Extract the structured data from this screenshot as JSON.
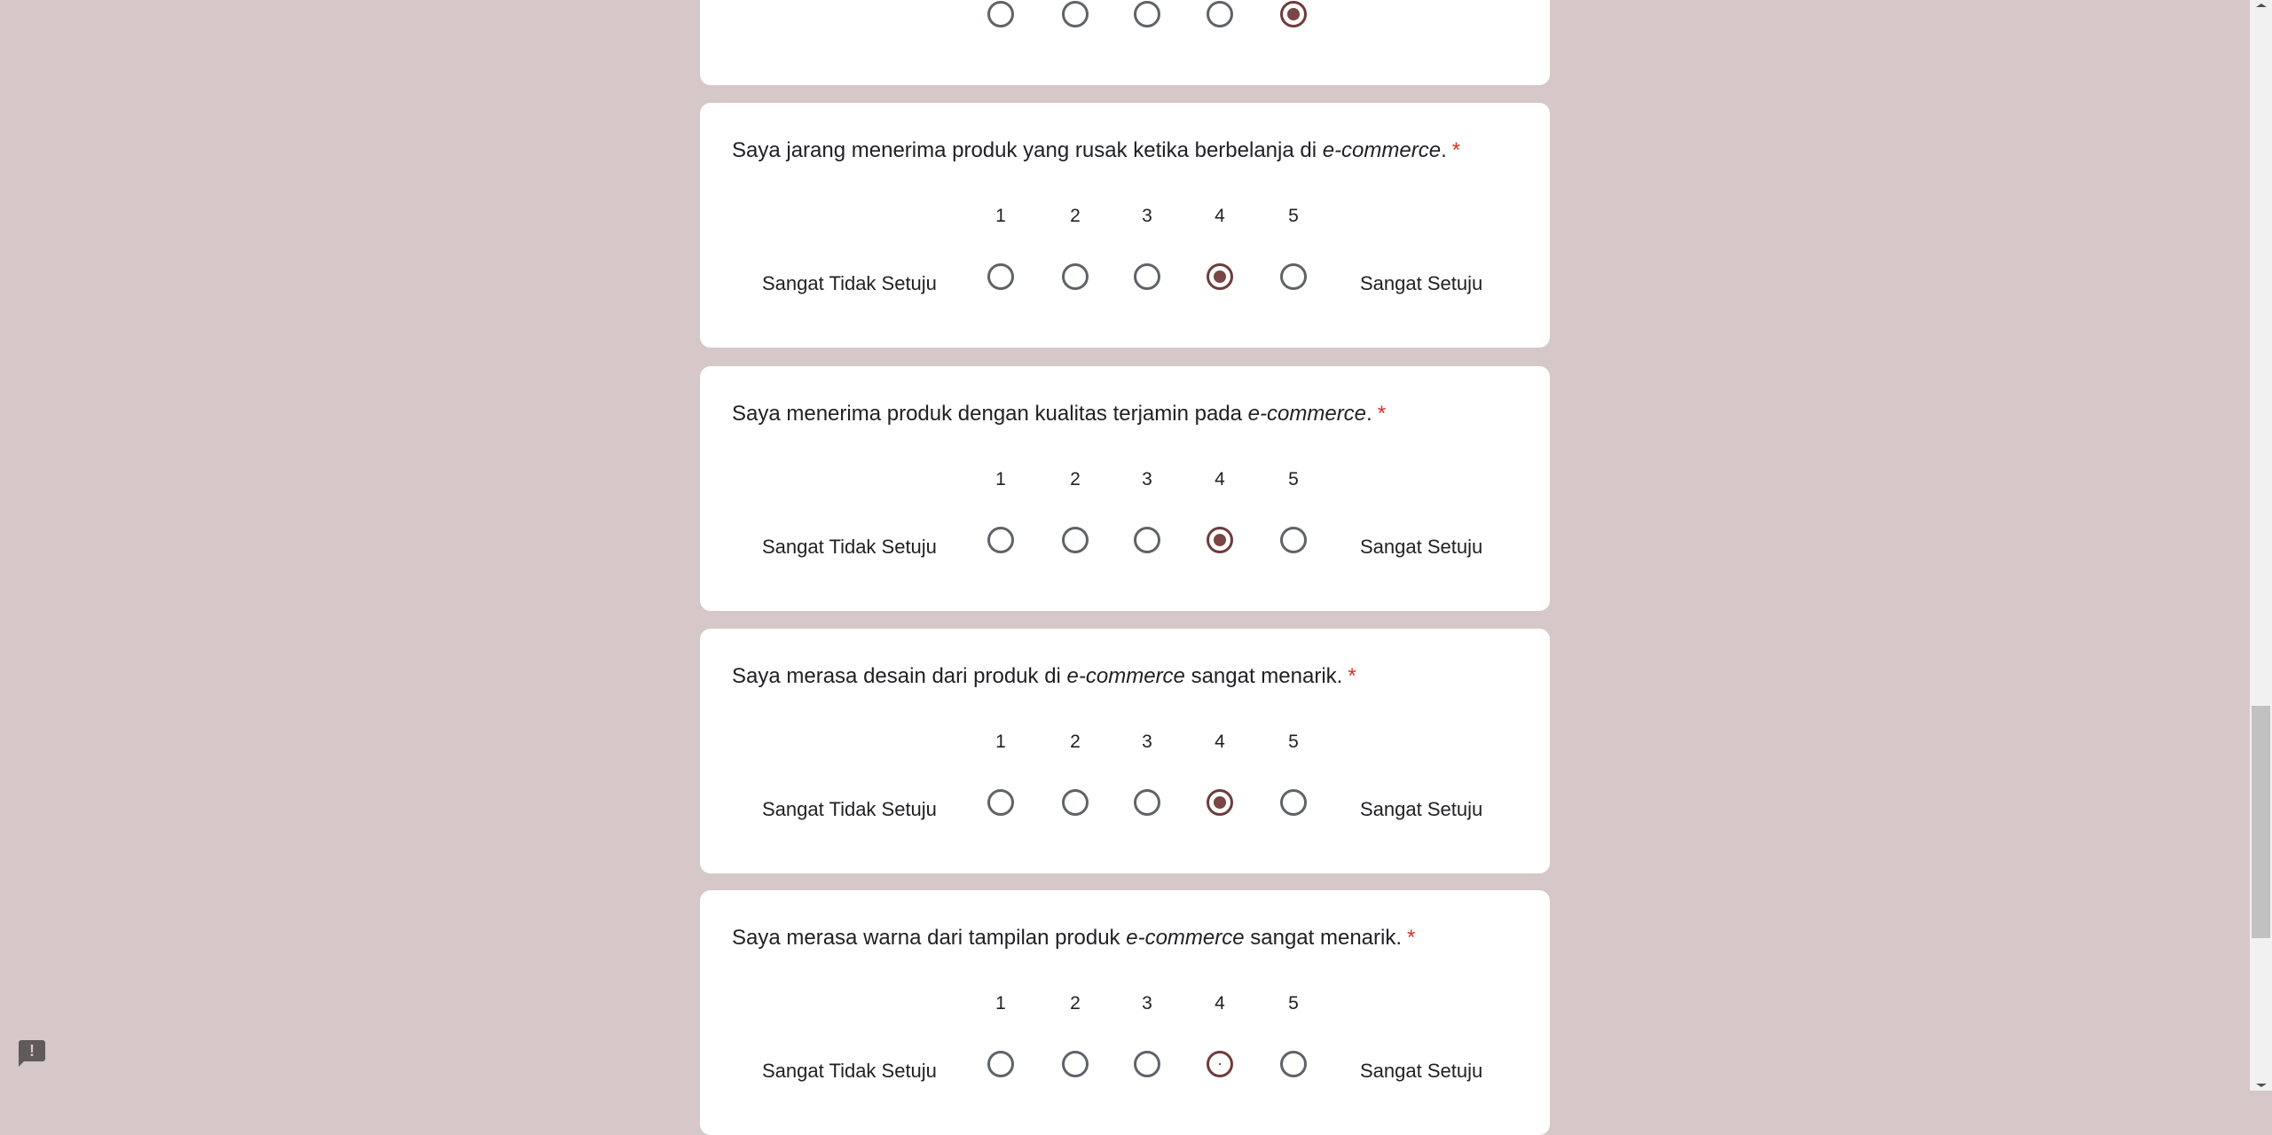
{
  "scale": {
    "numbers": [
      "1",
      "2",
      "3",
      "4",
      "5"
    ],
    "low_label": "Sangat Tidak Setuju",
    "high_label": "Sangat Setuju"
  },
  "required_mark": "*",
  "questions": [
    {
      "before": "",
      "italic": "",
      "after": "",
      "selected": 5,
      "state": "selected"
    },
    {
      "before": "Saya jarang menerima produk yang rusak ketika berbelanja di ",
      "italic": "e-commerce",
      "after": ".",
      "selected": 4,
      "state": "selected"
    },
    {
      "before": "Saya menerima produk dengan kualitas terjamin pada ",
      "italic": "e-commerce",
      "after": ".",
      "selected": 4,
      "state": "selected"
    },
    {
      "before": "Saya merasa desain dari produk di ",
      "italic": "e-commerce",
      "after": " sangat menarik.",
      "selected": 4,
      "state": "selected"
    },
    {
      "before": "Saya merasa warna dari tampilan produk ",
      "italic": "e-commerce",
      "after": " sangat menarik.",
      "selected": 4,
      "state": "focus"
    }
  ],
  "colors": {
    "background": "#d6c8c8",
    "accent": "#7a4545",
    "required": "#d93025"
  },
  "feedback_icon": "report-feedback-icon"
}
